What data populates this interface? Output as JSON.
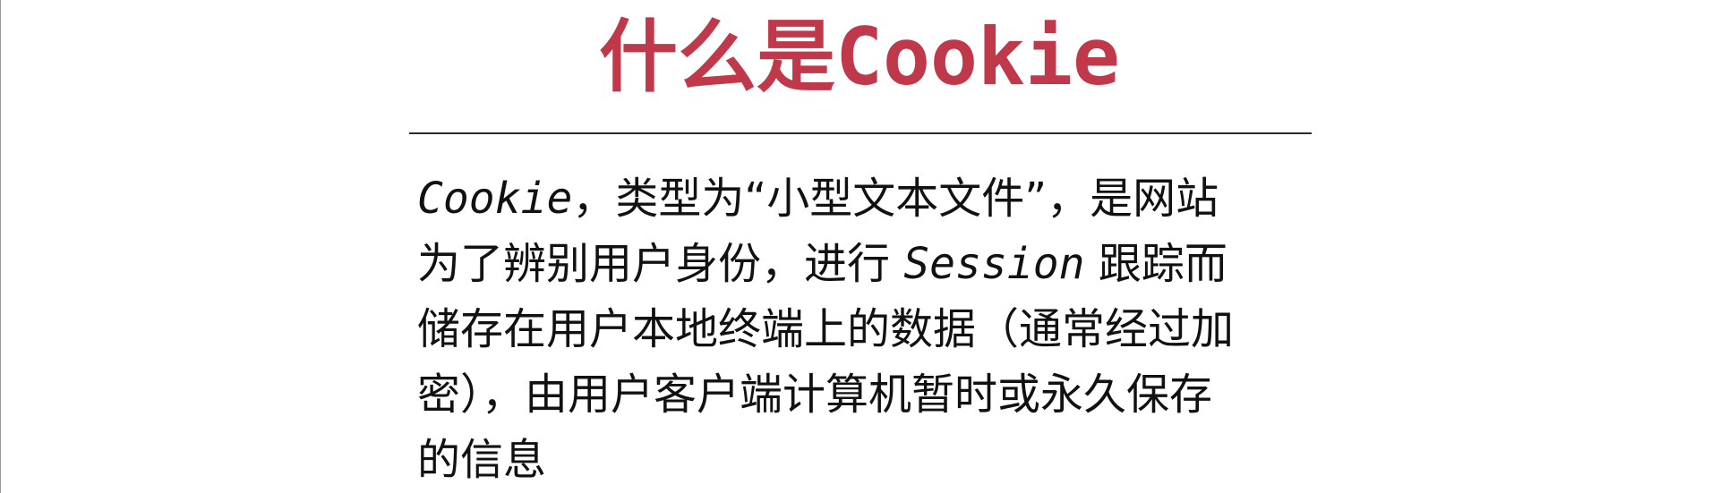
{
  "colors": {
    "title": "#c0394b",
    "text": "#111111",
    "rule": "#2b2b2b"
  },
  "title": {
    "prefix": "什么是",
    "keyword": "Cookie"
  },
  "paragraph": {
    "line1_term": "Cookie",
    "line1_rest": "，类型为“小型文本文件”，是网站",
    "line2_before": "为了辨别用户身份，进行 ",
    "line2_term": "Session",
    "line2_after": " 跟踪而",
    "line3": "储存在用户本地终端上的数据（通常经过加",
    "line4": "密），由用户客户端计算机暂时或永久保存",
    "line5": "的信息"
  }
}
